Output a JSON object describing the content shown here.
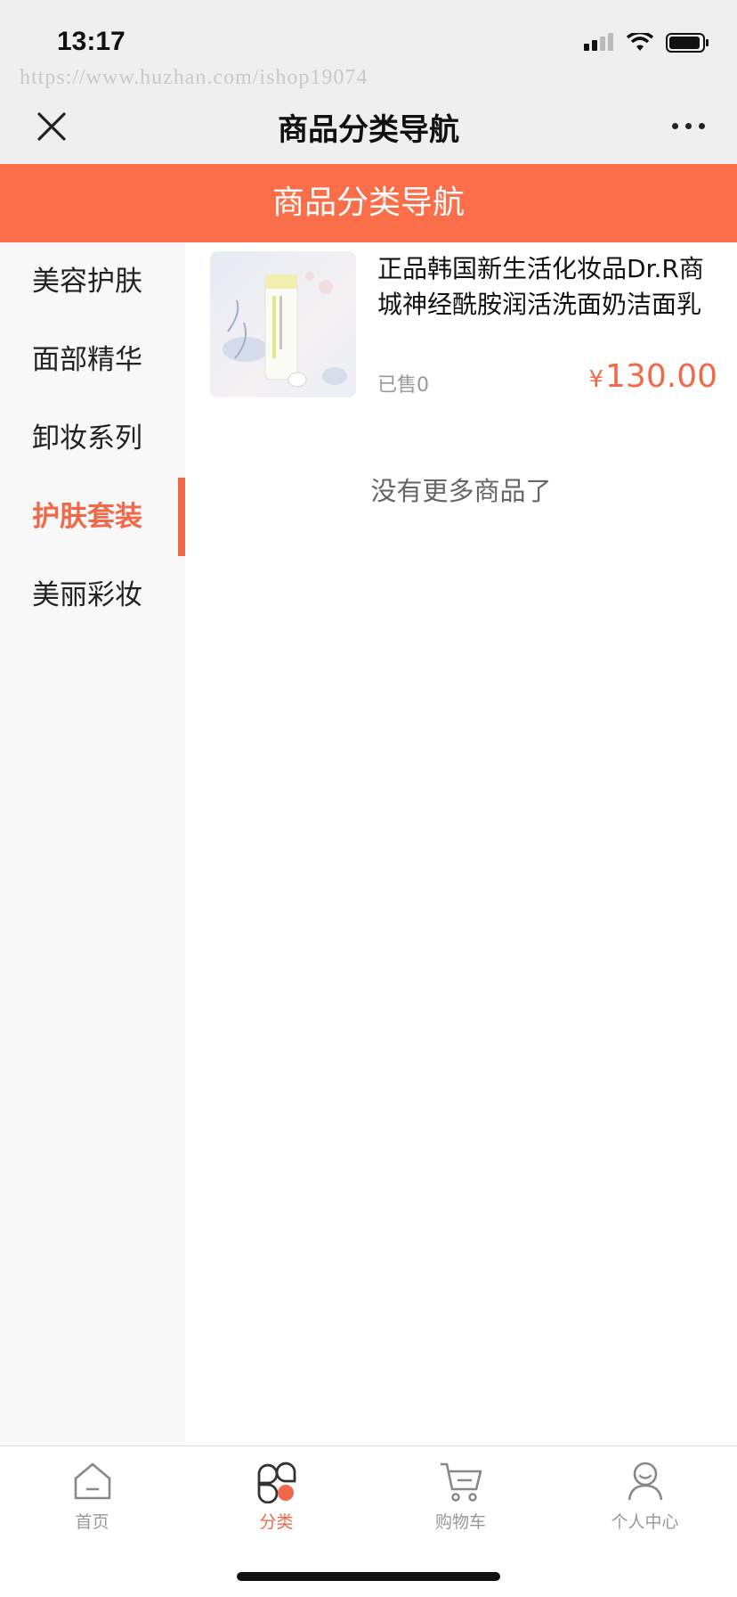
{
  "status": {
    "time": "13:17",
    "watermark": "https://www.huzhan.com/ishop19074"
  },
  "nav": {
    "title": "商品分类导航"
  },
  "header": {
    "title": "商品分类导航",
    "color": "#fa6e4a"
  },
  "sidebar": {
    "items": [
      {
        "label": "美容护肤",
        "active": false
      },
      {
        "label": "面部精华",
        "active": false
      },
      {
        "label": "卸妆系列",
        "active": false
      },
      {
        "label": "护肤套装",
        "active": true
      },
      {
        "label": "美丽彩妆",
        "active": false
      }
    ]
  },
  "products": [
    {
      "name": "正品韩国新生活化妆品Dr.R商城神经酰胺润活洗面奶洁面乳",
      "sold": "已售0",
      "currency": "¥",
      "price": "130.00"
    }
  ],
  "list": {
    "no_more": "没有更多商品了"
  },
  "tabbar": {
    "items": [
      {
        "label": "首页",
        "icon": "home-icon",
        "active": false
      },
      {
        "label": "分类",
        "icon": "category-icon",
        "active": true
      },
      {
        "label": "购物车",
        "icon": "cart-icon",
        "active": false
      },
      {
        "label": "个人中心",
        "icon": "user-icon",
        "active": false
      }
    ]
  },
  "colors": {
    "accent": "#f0694a"
  }
}
